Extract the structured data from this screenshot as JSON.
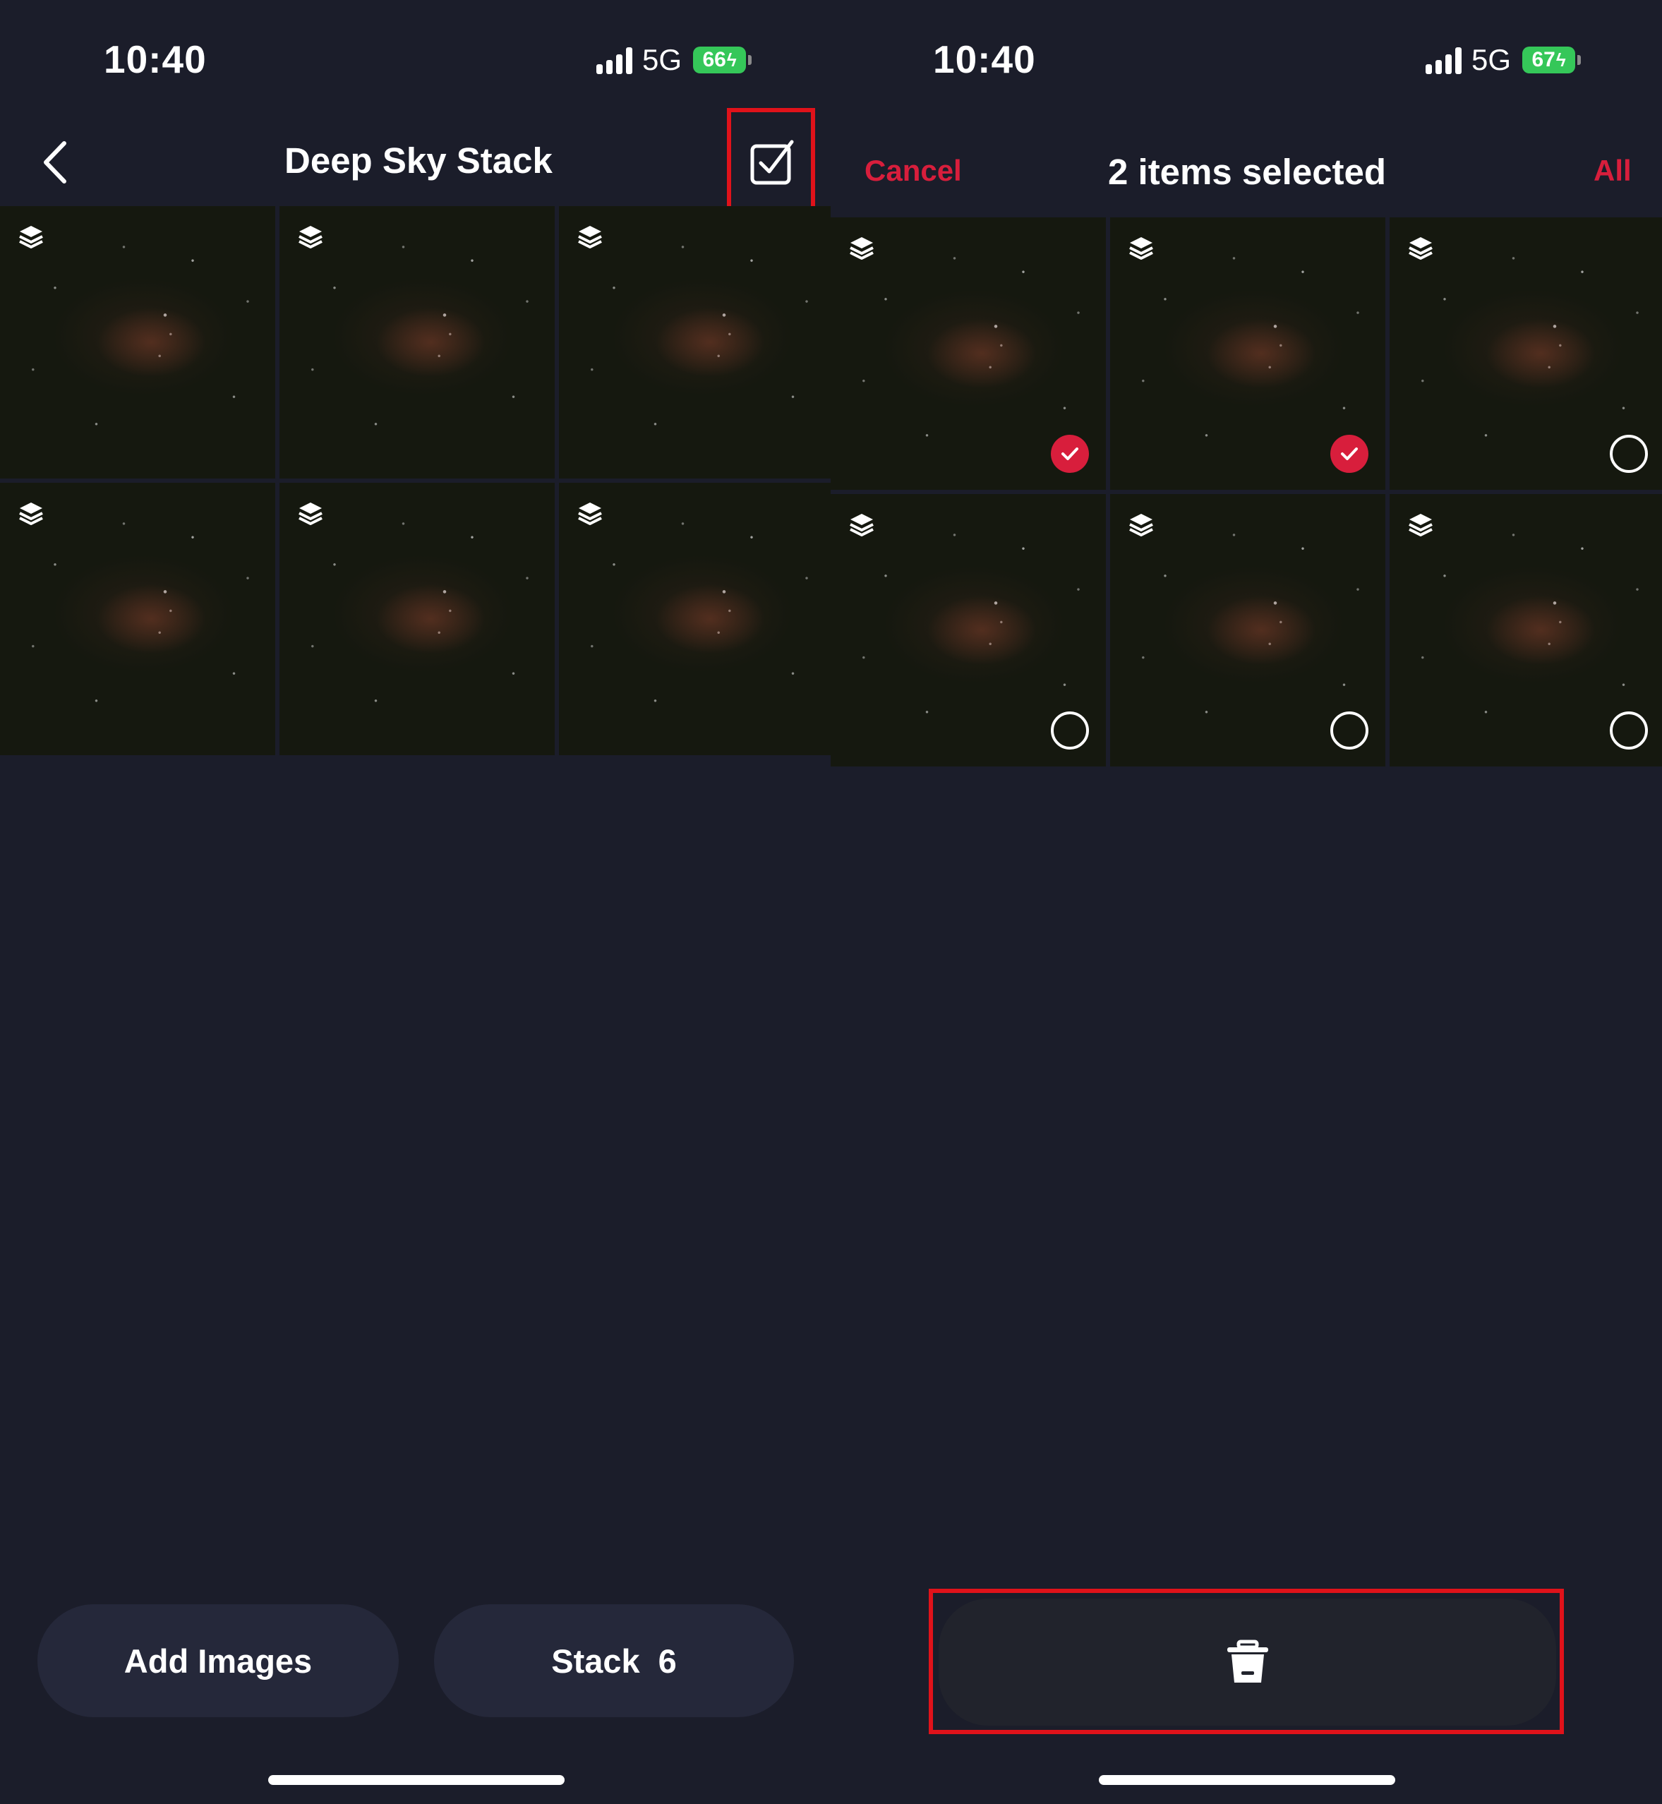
{
  "left": {
    "status": {
      "time": "10:40",
      "network": "5G",
      "battery": "66"
    },
    "header": {
      "title": "Deep Sky Stack"
    },
    "images": [
      {
        "label": "stack-image-1"
      },
      {
        "label": "stack-image-2"
      },
      {
        "label": "stack-image-3"
      },
      {
        "label": "stack-image-4"
      },
      {
        "label": "stack-image-5"
      },
      {
        "label": "stack-image-6"
      }
    ],
    "footer": {
      "add_images": "Add Images",
      "stack_label": "Stack",
      "stack_count": "6"
    }
  },
  "right": {
    "status": {
      "time": "10:40",
      "network": "5G",
      "battery": "67"
    },
    "header": {
      "cancel": "Cancel",
      "title": "2 items selected",
      "all": "All"
    },
    "images": [
      {
        "selected": true
      },
      {
        "selected": true
      },
      {
        "selected": false
      },
      {
        "selected": false
      },
      {
        "selected": false
      },
      {
        "selected": false
      }
    ]
  },
  "colors": {
    "accent": "#d81e3c",
    "background": "#1b1d2a",
    "battery": "#35c759",
    "highlight": "#e0121a"
  },
  "icons": [
    "back-chevron-icon",
    "select-checkbox-icon",
    "layers-icon",
    "trash-icon",
    "checkmark-icon"
  ]
}
